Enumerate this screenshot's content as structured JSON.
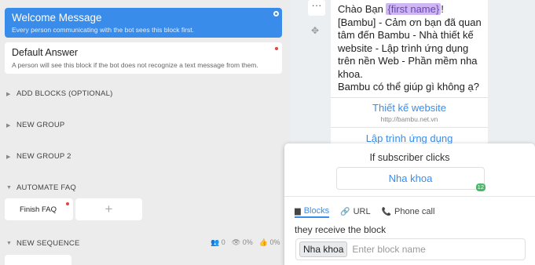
{
  "blocks": {
    "welcome": {
      "title": "Welcome Message",
      "desc": "Every person communicating with the bot sees this block first."
    },
    "default": {
      "title": "Default Answer",
      "desc": "A person will see this block if the bot does not recognize a text message from them."
    }
  },
  "sections": {
    "add_blocks": "ADD BLOCKS (OPTIONAL)",
    "new_group": "NEW GROUP",
    "new_group_2": "NEW GROUP 2",
    "automate_faq": "AUTOMATE FAQ",
    "new_sequence": "NEW SEQUENCE"
  },
  "faq": {
    "card": "Finish FAQ",
    "add": "+"
  },
  "sequence_stats": {
    "users": "0",
    "views": "0%",
    "likes": "0%"
  },
  "toolbar": {
    "more": "···",
    "move": "✥"
  },
  "message": {
    "greeting": "Chào Bạn",
    "tag": "{first name}",
    "excl": "!",
    "body": "[Bambu] - Cảm ơn bạn đã quan tâm đến Bambu - Nhà thiết kế website - Lập trình ứng dụng trên nền Web - Phần mềm nha khoa.",
    "question": "Bambu có thể giúp gì không ạ?",
    "buttons": [
      {
        "label": "Thiết kế website",
        "url": "http://bambu.net.vn"
      },
      {
        "label": "Lập trình ứng dụng"
      }
    ]
  },
  "popup": {
    "if_label": "If subscriber clicks",
    "button_label": "Nha khoa",
    "badge": "12",
    "tabs": [
      {
        "label": "Blocks"
      },
      {
        "label": "URL"
      },
      {
        "label": "Phone call"
      }
    ],
    "receive_label": "they receive the block",
    "chip": "Nha khoa",
    "placeholder": "Enter block name"
  },
  "colors": {
    "accent": "#3a8cea",
    "tag_bg": "#cdb6f2",
    "badge": "#49b86b",
    "dot": "#e8423e"
  }
}
